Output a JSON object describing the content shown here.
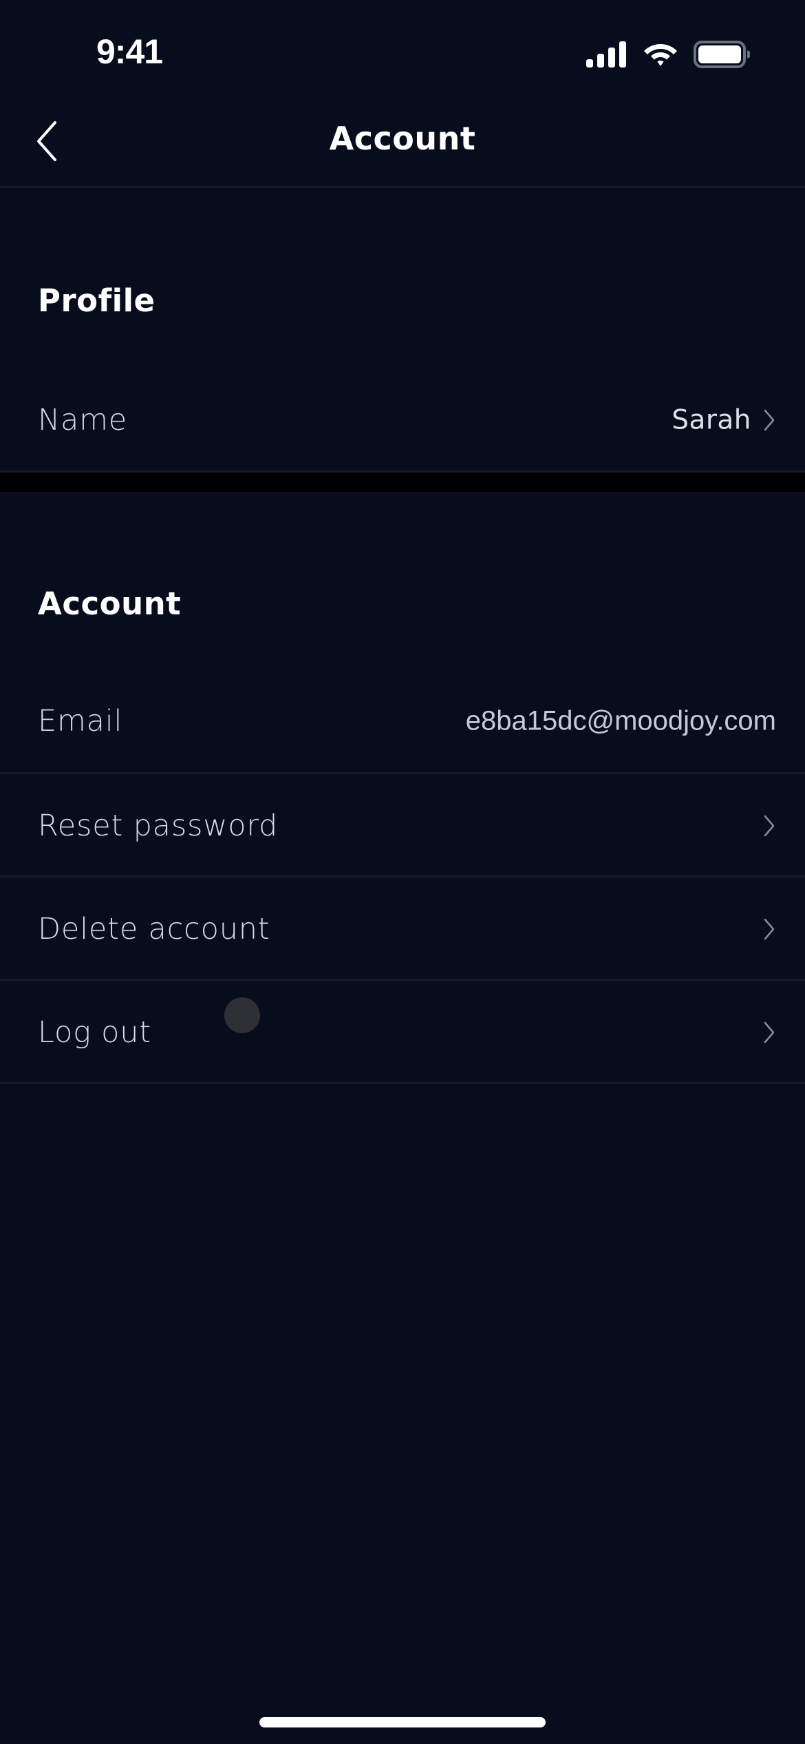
{
  "status_bar": {
    "time": "9:41",
    "icons": [
      "signal-icon",
      "wifi-icon",
      "battery-icon"
    ]
  },
  "header": {
    "back_icon": "chevron-left-icon",
    "title": "Account"
  },
  "sections": [
    {
      "title": "Profile",
      "rows": [
        {
          "label": "Name",
          "value": "Sarah",
          "chevron": true
        }
      ]
    },
    {
      "title": "Account",
      "rows": [
        {
          "label": "Email",
          "value": "e8ba15dc@moodjoy.com",
          "chevron": false
        },
        {
          "label": "Reset password",
          "value": "",
          "chevron": true
        },
        {
          "label": "Delete account",
          "value": "",
          "chevron": true
        },
        {
          "label": "Log out",
          "value": "",
          "chevron": true
        }
      ]
    }
  ],
  "colors": {
    "background": "#070d1c",
    "section_gap": "#000002",
    "divider": "#131929",
    "label_text": "#d6d9e2",
    "chevron": "#8a8d96"
  }
}
